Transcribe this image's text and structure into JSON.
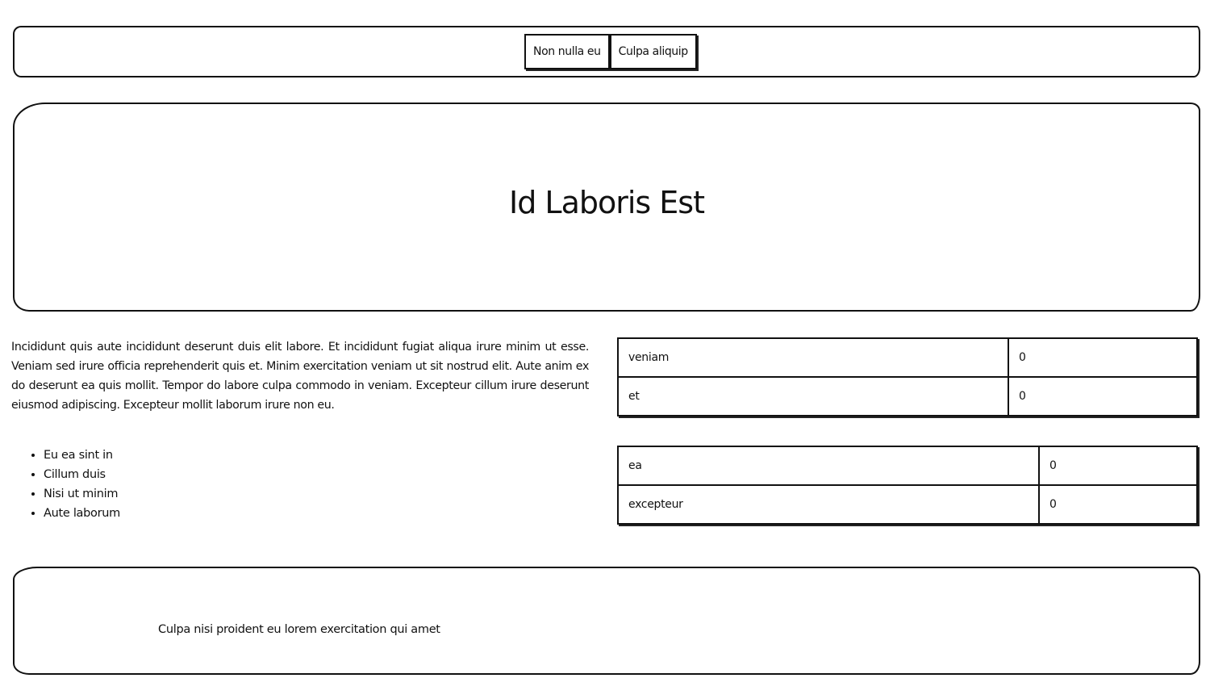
{
  "nav": {
    "items": [
      {
        "label": "Non nulla eu"
      },
      {
        "label": "Culpa aliquip"
      }
    ]
  },
  "header": {
    "title": "Id Laboris Est"
  },
  "main": {
    "paragraph": "Incididunt quis aute incididunt deserunt duis elit labore. Et incididunt fugiat aliqua irure minim ut esse. Veniam sed irure officia reprehenderit quis et. Minim exercitation veniam ut sit nostrud elit. Aute anim ex do deserunt ea quis mollit. Tempor do labore culpa commodo in veniam. Excepteur cillum irure deserunt eiusmod adipiscing. Excepteur mollit laborum irure non eu.",
    "list": [
      "Eu ea sint in",
      "Cillum duis",
      "Nisi ut minim",
      "Aute laborum"
    ]
  },
  "tables": [
    {
      "rows": [
        {
          "key": "veniam",
          "value": "0"
        },
        {
          "key": "et",
          "value": "0"
        }
      ]
    },
    {
      "rows": [
        {
          "key": "ea",
          "value": "0"
        },
        {
          "key": "excepteur",
          "value": "0"
        }
      ]
    }
  ],
  "footer": {
    "text": "Culpa nisi proident eu lorem exercitation qui amet"
  }
}
